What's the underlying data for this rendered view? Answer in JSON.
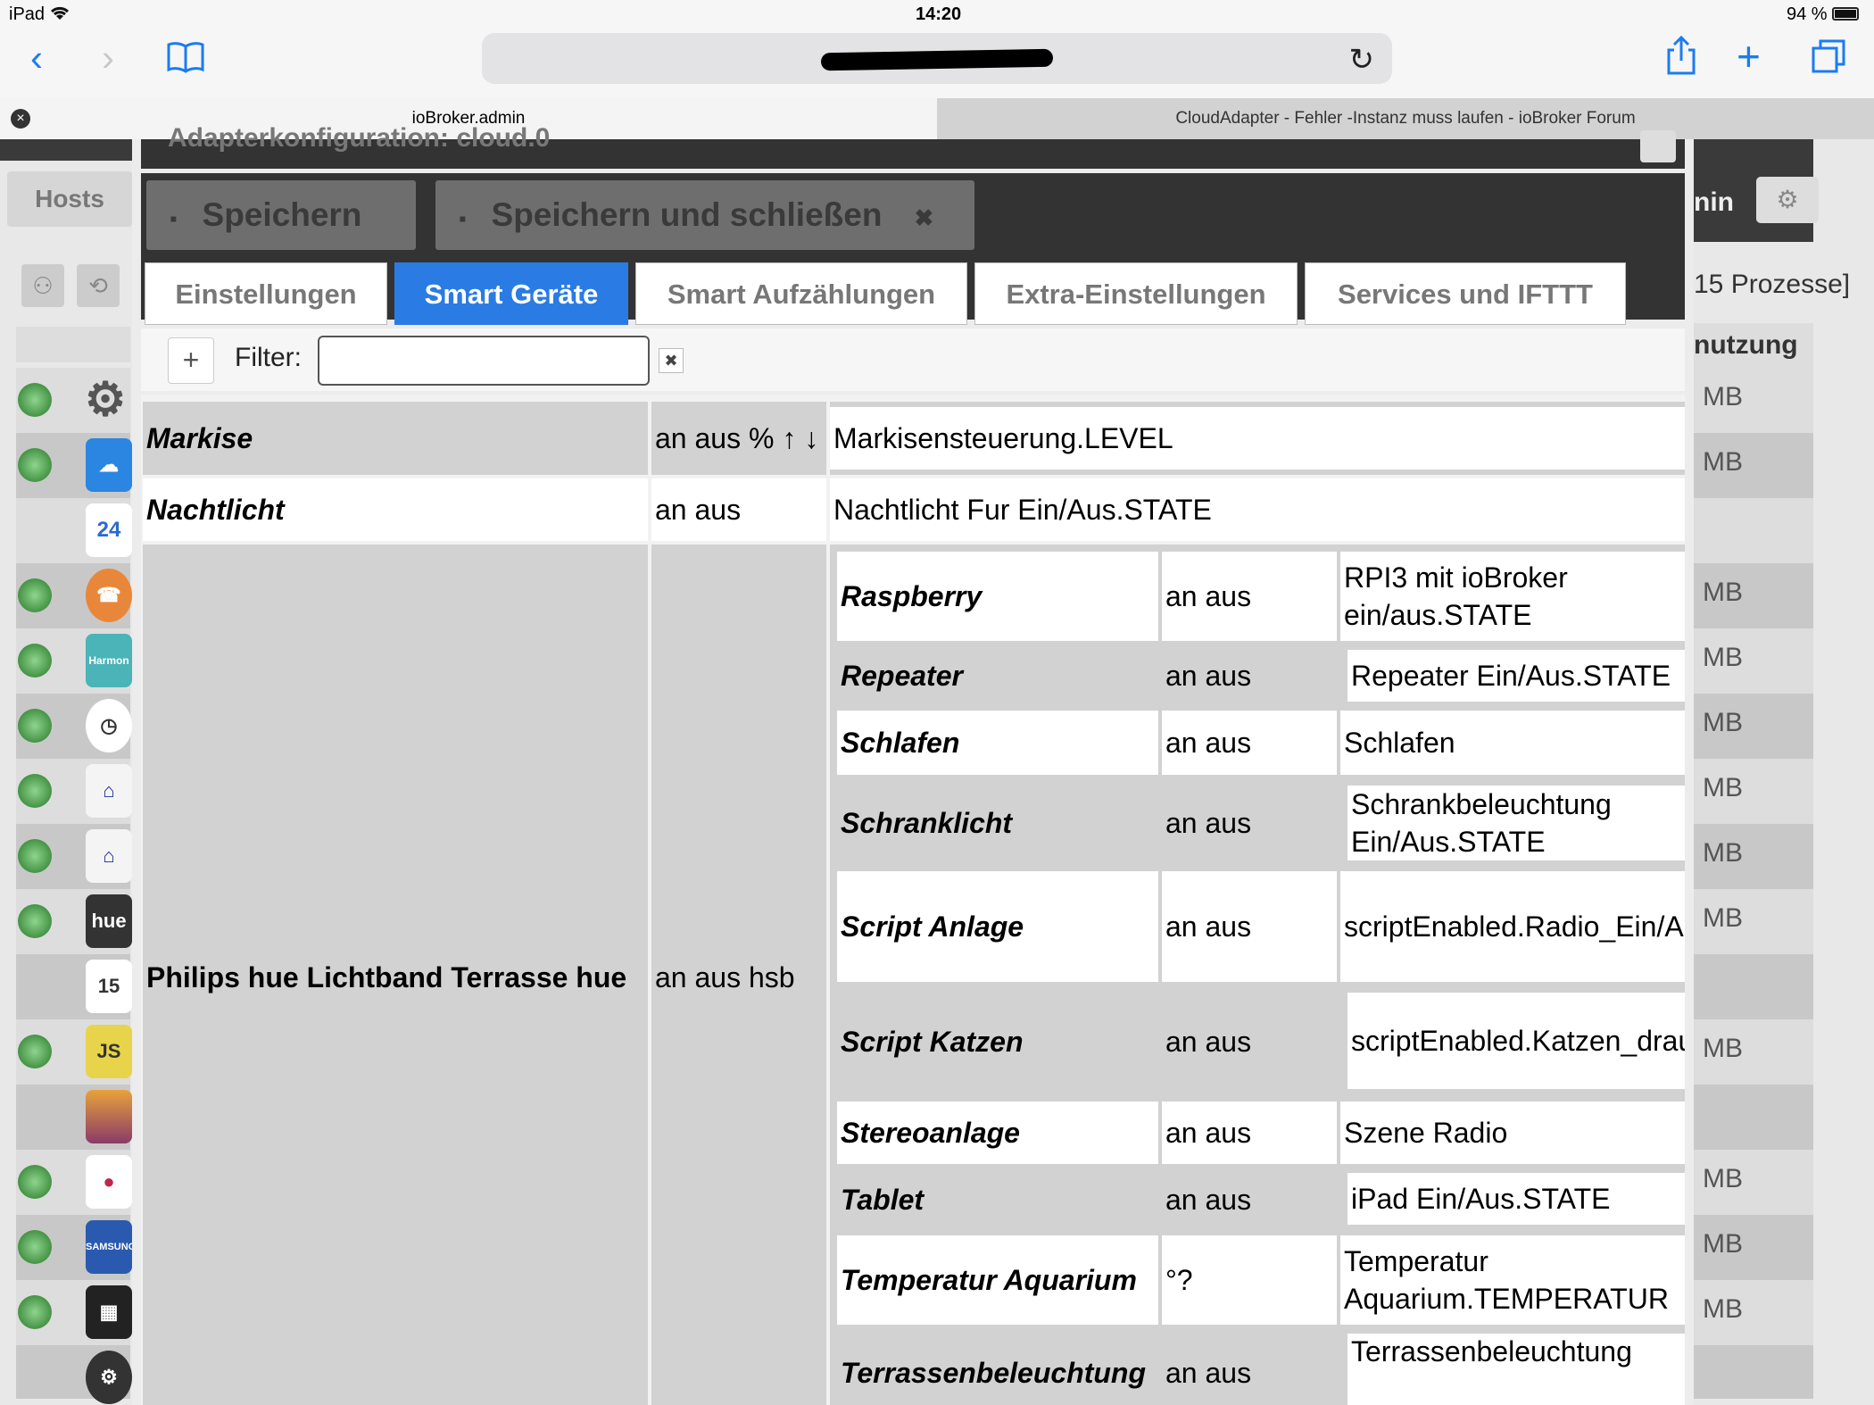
{
  "status_bar": {
    "device": "iPad",
    "time": "14:20",
    "battery": "94 %"
  },
  "browser": {
    "tabs": [
      {
        "label": "ioBroker.admin"
      },
      {
        "label": "CloudAdapter - Fehler -Instanz muss laufen - ioBroker Forum"
      }
    ]
  },
  "background": {
    "hosts_tab": "Hosts",
    "header_right": "nin",
    "process_count": "15 Prozesse]",
    "column_header": "nutzung",
    "unit": "MB"
  },
  "modal": {
    "title": "Adapterkonfiguration: cloud.0",
    "buttons": {
      "save": "Speichern",
      "save_close": "Speichern und schließen"
    },
    "tabs": [
      "Einstellungen",
      "Smart Geräte",
      "Smart Aufzählungen",
      "Extra-Einstellungen",
      "Services und IFTTT"
    ],
    "active_tab": "Smart Geräte",
    "filter": {
      "label": "Filter:",
      "value": ""
    }
  },
  "devices": [
    {
      "name": "Markise",
      "actions": "an aus % ↑ ↓",
      "object": "Markisensteuerung.LEVEL"
    },
    {
      "name": "Nachtlicht",
      "actions": "an aus",
      "object": "Nachtlicht Fur Ein/Aus.STATE"
    }
  ],
  "group": {
    "name": "Philips hue Lichtband Terrasse hue",
    "actions": "an aus hsb",
    "rows": [
      {
        "name": "Raspberry",
        "actions": "an aus",
        "object": "RPI3 mit ioBroker ein/aus.STATE"
      },
      {
        "name": "Repeater",
        "actions": "an aus",
        "object": "Repeater Ein/Aus.STATE"
      },
      {
        "name": "Schlafen",
        "actions": "an aus",
        "object": "Schlafen"
      },
      {
        "name": "Schranklicht",
        "actions": "an aus",
        "object": "Schrankbeleuchtung Ein/Aus.STATE"
      },
      {
        "name": "Script Anlage",
        "actions": "an aus",
        "object": "scriptEnabled.Radio_Ein/Aus"
      },
      {
        "name": "Script Katzen",
        "actions": "an aus",
        "object": "scriptEnabled.Katzen_draußen"
      },
      {
        "name": "Stereoanlage",
        "actions": "an aus",
        "object": "Szene Radio"
      },
      {
        "name": "Tablet",
        "actions": "an aus",
        "object": "iPad Ein/Aus.STATE"
      },
      {
        "name": "Temperatur Aquarium",
        "actions": "°?",
        "object": "Temperatur Aquarium.TEMPERATUR"
      },
      {
        "name": "Terrassenbeleuchtung",
        "actions": "an aus",
        "object": "Terrassenbeleuchtung"
      }
    ]
  }
}
